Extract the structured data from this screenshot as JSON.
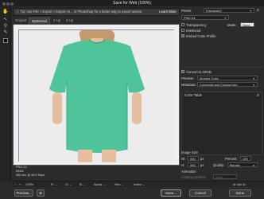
{
  "window": {
    "title": "Save for Web (100%)"
  },
  "tip": {
    "text": "Tip: Use File > Export > Export As... in Photoshop for a faster way to export assets.",
    "learn_more": "Learn More"
  },
  "tabs": [
    "Original",
    "Optimized",
    "2-Up",
    "4-Up"
  ],
  "active_tab": "Optimized",
  "image_info": {
    "format": "PNG-24",
    "size": "530M",
    "time": "465 sec @ 56.6 Kbps"
  },
  "preset": {
    "label": "Preset:",
    "value": "[Unnamed]"
  },
  "format": {
    "value": "PNG-24"
  },
  "options": {
    "transparency": "Transparency",
    "matte_label": "Matte:",
    "matte_value": "None",
    "interlaced": "Interlaced",
    "embed_profile": "Embed Color Profile"
  },
  "color": {
    "convert_srgb": "Convert to sRGB",
    "preview_label": "Preview:",
    "preview_value": "Monitor Color",
    "metadata_label": "Metadata:",
    "metadata_value": "Copyright and Contact Info",
    "color_table": "Color Table"
  },
  "image_size": {
    "title": "Image Size",
    "w_label": "W:",
    "w_value": "530",
    "h_label": "H:",
    "h_value": "530",
    "unit": "px",
    "percent_label": "Percent:",
    "percent_value": "100",
    "quality_label": "Quality:",
    "quality_value": "Bicubic"
  },
  "animation": {
    "title": "Animation",
    "looping_label": "Looping Options:",
    "looping_value": "Once"
  },
  "status": {
    "zoom": "100%",
    "r": "R: --",
    "g": "G: --",
    "b": "B: --",
    "alpha": "Alpha: --",
    "hex": "Hex: --",
    "index": "Index: --"
  },
  "buttons": {
    "preview": "Preview...",
    "save": "Save...",
    "cancel": "Cancel",
    "done": "Done"
  },
  "colors": {
    "shirt": "#4fc49a",
    "shirt_shadow": "#3aa883",
    "skin": "#e9c3a6",
    "hair": "#c49a6c",
    "bg": "#ececec"
  }
}
